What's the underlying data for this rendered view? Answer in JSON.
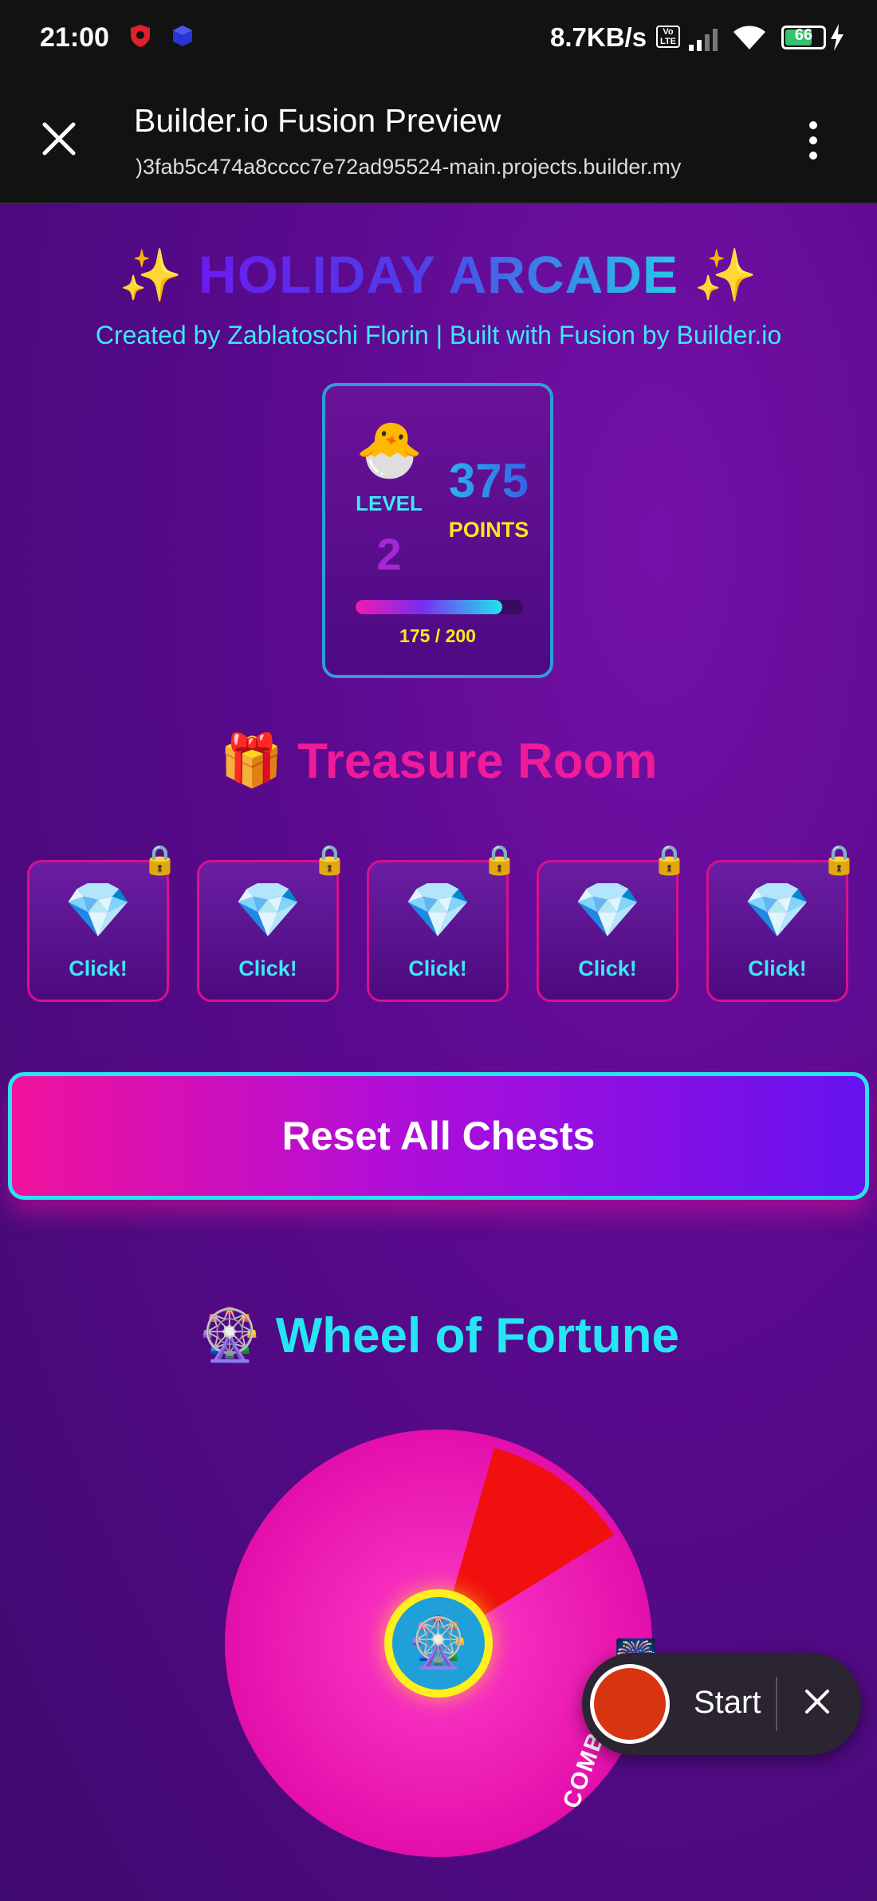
{
  "status_bar": {
    "time": "21:00",
    "network_speed": "8.7KB/s",
    "volte": "Vo LTE",
    "battery": "66",
    "icons": [
      "shield-icon",
      "vpn-cube-icon",
      "signal-icon",
      "wifi-icon",
      "battery-icon",
      "charging-bolt-icon"
    ]
  },
  "browser": {
    "title": "Builder.io Fusion Preview",
    "url": ")3fab5c474a8cccc7e72ad95524-main.projects.builder.my",
    "close_icon": "close-icon",
    "menu_icon": "more-vert-icon"
  },
  "header": {
    "sparkle_left": "✨",
    "title": "HOLIDAY ARCADE",
    "sparkle_right": "✨",
    "credits": "Created by Zablatoschi Florin | Built with Fusion by Builder.io"
  },
  "stats": {
    "avatar": "🐣",
    "level_label": "LEVEL",
    "level_value": "2",
    "points_value": "375",
    "points_label": "POINTS",
    "progress_text": "175 / 200",
    "progress_fraction": 0.875
  },
  "treasure": {
    "emoji": "🎁",
    "title": "Treasure Room",
    "chests": [
      {
        "gem": "💎",
        "label": "Click!",
        "lock": "🔒"
      },
      {
        "gem": "💎",
        "label": "Click!",
        "lock": "🔒"
      },
      {
        "gem": "💎",
        "label": "Click!",
        "lock": "🔒"
      },
      {
        "gem": "💎",
        "label": "Click!",
        "lock": "🔒"
      },
      {
        "gem": "💎",
        "label": "Click!",
        "lock": "🔒"
      }
    ],
    "reset_label": "Reset All Chests"
  },
  "wheel": {
    "emoji": "🎡",
    "title": "Wheel of Fortune",
    "center_icon": "🎡",
    "prize_icon": "🎆",
    "prize_label": "COMBO",
    "colors": {
      "main": "#f012b4",
      "highlight": "#f01010"
    }
  },
  "recorder": {
    "start_label": "Start",
    "close_icon": "close-icon"
  },
  "colors": {
    "background": "#5a0a8e",
    "cyan": "#28e4f2",
    "pink": "#ef1b98",
    "yellow": "#ffe81c"
  }
}
